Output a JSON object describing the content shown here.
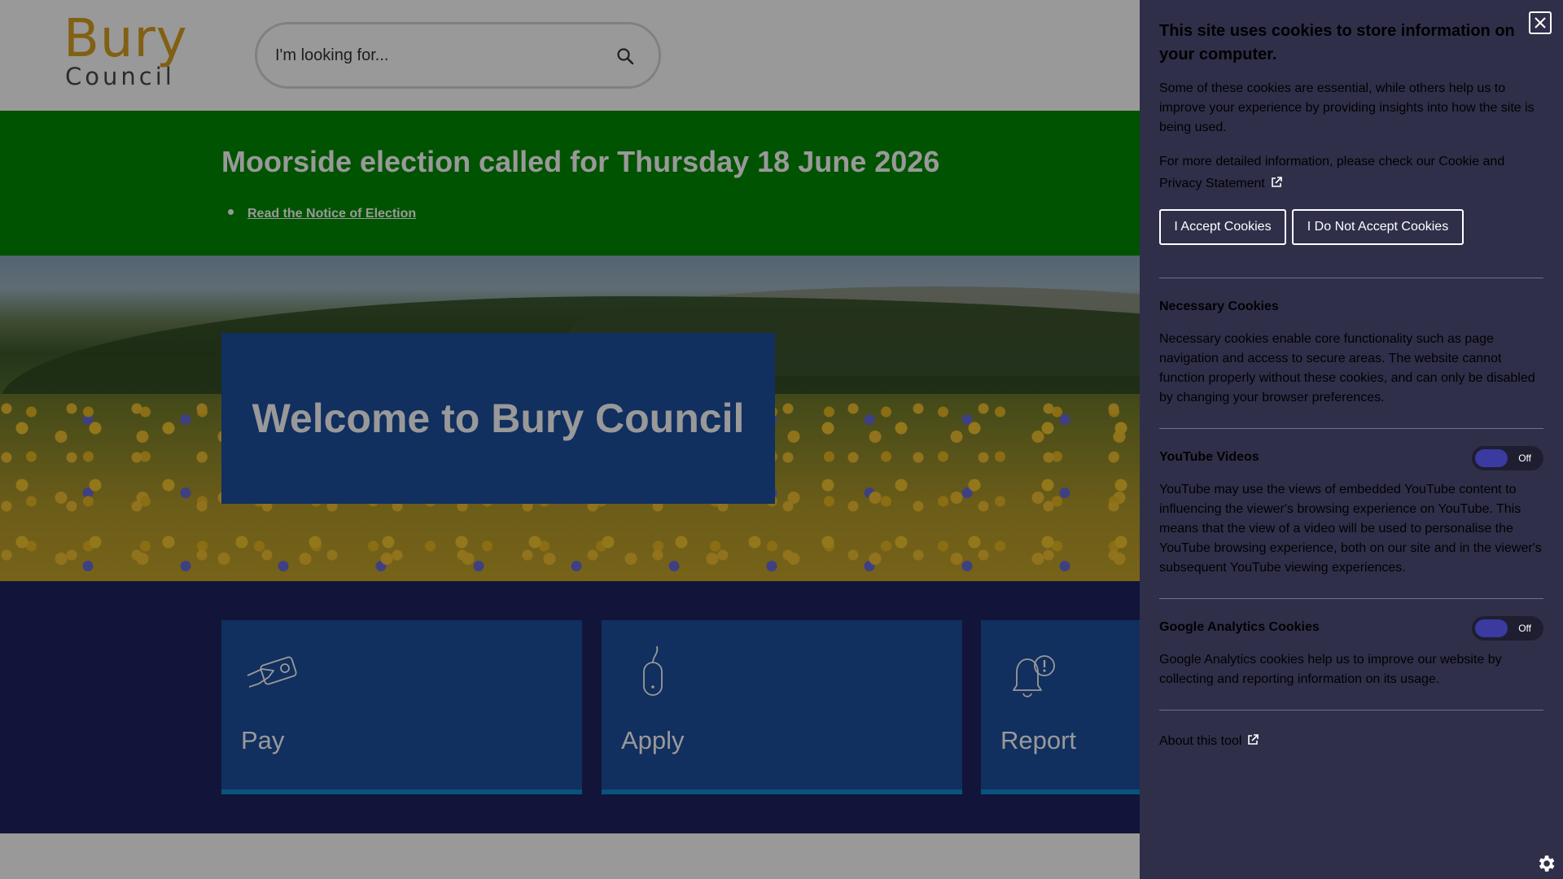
{
  "header": {
    "logo_top": "Bury",
    "logo_bottom": "Council",
    "search_placeholder": "I'm looking for..."
  },
  "banner": {
    "title": "Moorside election called for Thursday 18 June 2026",
    "link": "Read the Notice of Election"
  },
  "hero": {
    "title": "Welcome to Bury Council"
  },
  "tiles": [
    {
      "label": "Pay",
      "icon": "card-payment-icon"
    },
    {
      "label": "Apply",
      "icon": "mouse-icon"
    },
    {
      "label": "Report",
      "icon": "bell-alert-icon"
    }
  ],
  "cookie": {
    "title": "This site uses cookies to store information on your computer.",
    "intro": "Some of these cookies are essential, while others help us to improve your experience by providing insights into how the site is being used.",
    "more_info": "For more detailed information, please check our Cookie and Privacy Statement",
    "accept_label": "I Accept Cookies",
    "reject_label": "I Do Not Accept Cookies",
    "necessary_title": "Necessary Cookies",
    "necessary_text": "Necessary cookies enable core functionality such as page navigation and access to secure areas. The website cannot function properly without these cookies, and can only be disabled by changing your browser preferences.",
    "youtube_title": "YouTube Videos",
    "youtube_toggle": "Off",
    "youtube_text": "YouTube may use the views of embedded YouTube content to influencing the viewer's browsing experience on YouTube. This means that the view of a video will be used to personalise the YouTube browsing experience, both on our site and in the viewer's subsequent YouTube viewing experiences.",
    "analytics_title": "Google Analytics Cookies",
    "analytics_toggle": "Off",
    "analytics_text": "Google Analytics cookies help us to improve our website by collecting and reporting information on its usage.",
    "about_label": "About this tool"
  },
  "colors": {
    "banner": "#008a00",
    "hero_box": "#1d4f9e",
    "tiles_bg": "#1e2360",
    "panel_bg": "#2f2f4a",
    "logo_gold": "#d8a020"
  }
}
